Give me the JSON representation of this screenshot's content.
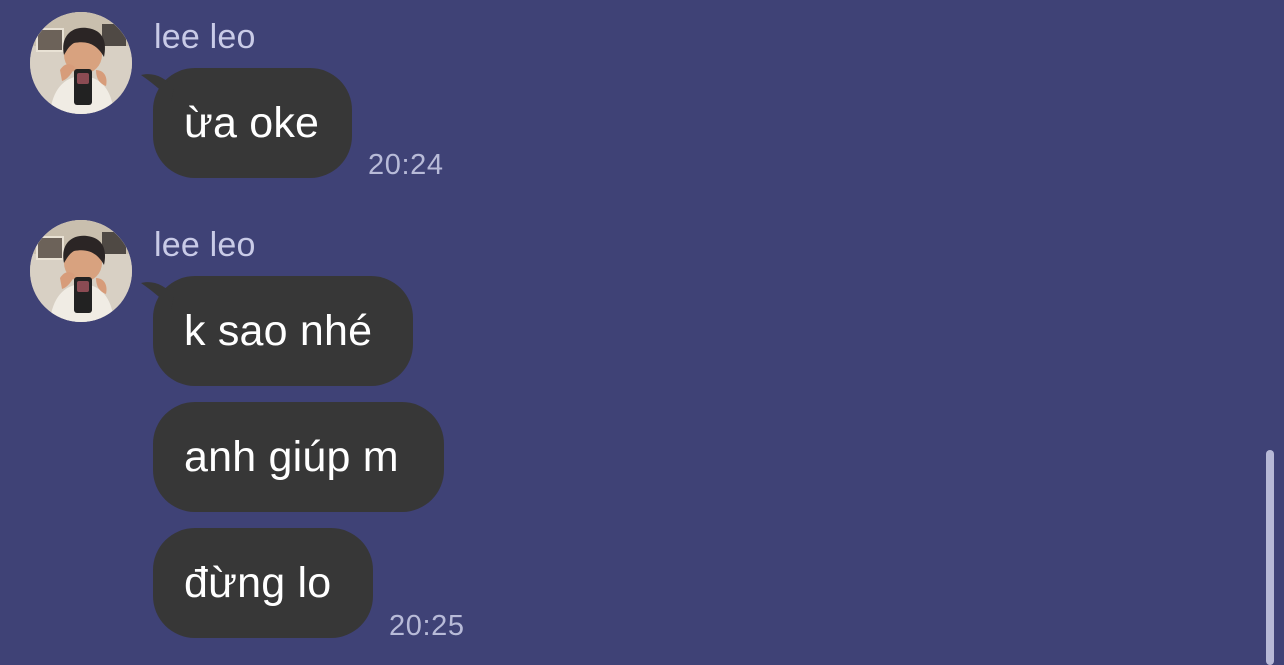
{
  "colors": {
    "background": "#3f4276",
    "bubble": "#373737",
    "bubble_text": "#ffffff",
    "meta_text": "#c9cbe7",
    "scrollbar": "#b7b9d6"
  },
  "messages": {
    "groups": [
      {
        "sender": "lee leo",
        "avatar_icon": "profile-photo-avatar",
        "bubbles": [
          {
            "text": "ừa oke"
          }
        ],
        "time": "20:24"
      },
      {
        "sender": "lee leo",
        "avatar_icon": "profile-photo-avatar",
        "bubbles": [
          {
            "text": "k sao nhé"
          },
          {
            "text": "anh giúp m"
          },
          {
            "text": "đừng lo"
          }
        ],
        "time": "20:25"
      }
    ]
  }
}
